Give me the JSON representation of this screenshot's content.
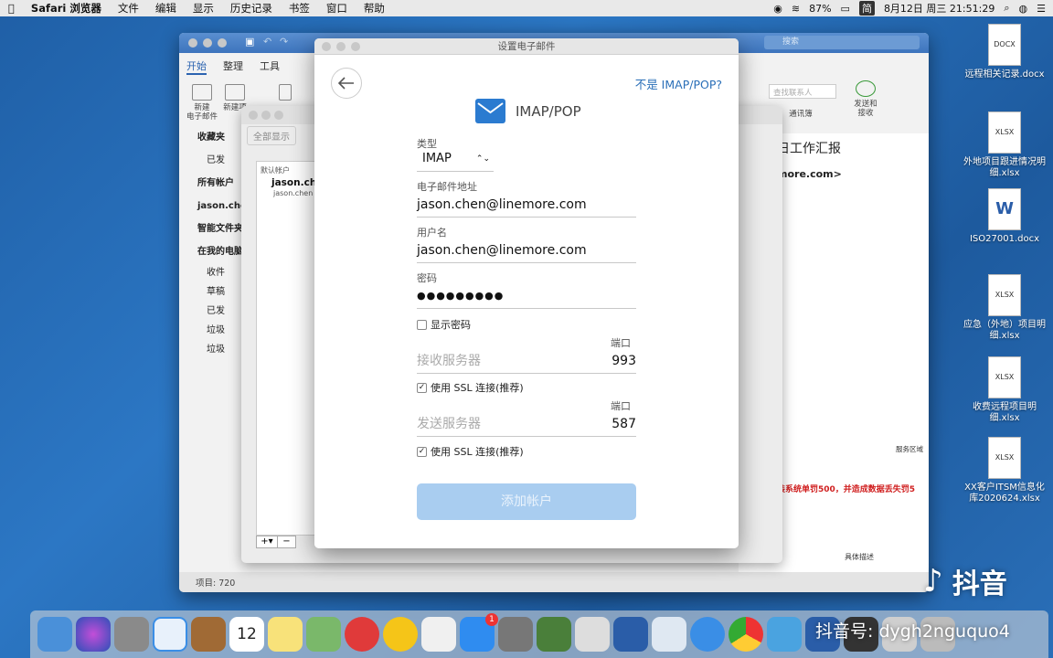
{
  "menubar": {
    "app": "Safari 浏览器",
    "items": [
      "文件",
      "编辑",
      "显示",
      "历史记录",
      "书签",
      "窗口",
      "帮助"
    ],
    "battery": "87%",
    "ime": "简",
    "datetime": "8月12日 周三  21:51:29"
  },
  "desktop_files": [
    {
      "name": "远程相关记录.docx",
      "kind": "DOCX"
    },
    {
      "name": "外地项目跟进情况明细.xlsx",
      "kind": "XLSX"
    },
    {
      "name": "ISO27001.docx",
      "kind": "W"
    },
    {
      "name": "应急（外地）项目明细.xlsx",
      "kind": "XLSX"
    },
    {
      "name": "收费远程项目明细.xlsx",
      "kind": "XLSX"
    },
    {
      "name": "XX客户ITSM信息化库2020624.xlsx",
      "kind": "XLSX"
    }
  ],
  "outlook": {
    "search_placeholder": "搜索",
    "tabs": [
      "开始",
      "整理",
      "工具"
    ],
    "ribbon": {
      "new_email": "新建\n电子邮件",
      "new_item": "新建项",
      "contact_search_placeholder": "查找联系人",
      "address_book": "通讯簿",
      "send_receive": "发送和\n接收"
    },
    "sidebar": {
      "favorites": "收藏夹",
      "sent_fav": "已发",
      "all_accounts": "所有帐户",
      "account": "jason.che",
      "smart_folders": "智能文件夹",
      "on_my_computer": "在我的电脑",
      "folders": [
        "收件",
        "草稿",
        "已发",
        "垃圾",
        "垃圾"
      ]
    },
    "preview_subject": "日工作汇报",
    "preview_from": "more.com>",
    "preview_service_area": "服务区域",
    "preview_red_text": "装系统单罚500，并造成数据丢失罚5",
    "preview_detail": "具体描述",
    "status": "项目: 720"
  },
  "accounts_window": {
    "show_all": "全部显示",
    "default_account": "默认帐户",
    "account_name": "jason.ch",
    "account_email": "jason.chen"
  },
  "dialog": {
    "title": "设置电子邮件",
    "not_imap": "不是 IMAP/POP?",
    "heading": "IMAP/POP",
    "type_label": "类型",
    "type_value": "IMAP",
    "email_label": "电子邮件地址",
    "email_value": "jason.chen@linemore.com",
    "username_label": "用户名",
    "username_value": "jason.chen@linemore.com",
    "password_label": "密码",
    "password_value": "●●●●●●●●●",
    "show_password": "显示密码",
    "port_label": "端口",
    "incoming_placeholder": "接收服务器",
    "incoming_port": "993",
    "incoming_ssl": "使用 SSL 连接(推荐)",
    "outgoing_placeholder": "发送服务器",
    "outgoing_port": "587",
    "outgoing_ssl": "使用 SSL 连接(推荐)",
    "add_account": "添加帐户"
  },
  "dock": {
    "calendar_day": "12",
    "badge": "1"
  },
  "watermark": {
    "logo": "抖音",
    "id": "抖音号: dygh2nguquo4"
  }
}
